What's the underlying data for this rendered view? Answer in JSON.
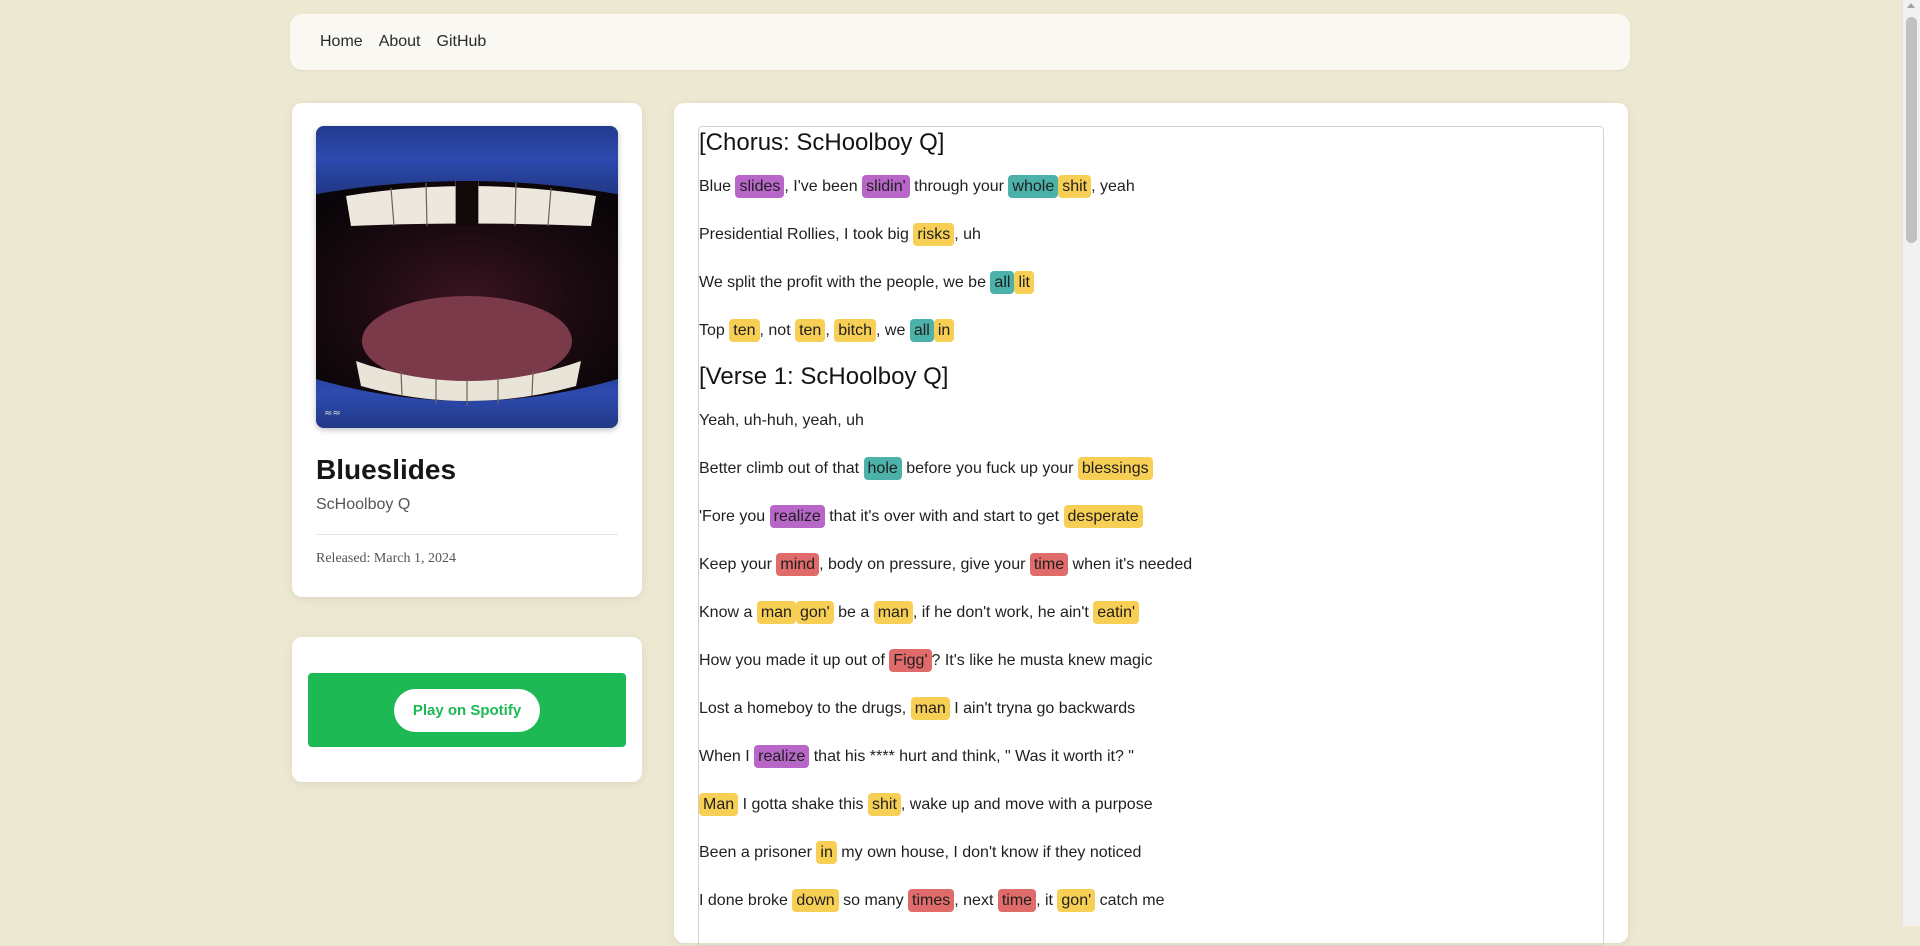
{
  "nav": {
    "links": [
      "Home",
      "About",
      "GitHub"
    ]
  },
  "album": {
    "title": "Blueslides",
    "artist": "ScHoolboy Q",
    "release": "Released: March 1, 2024"
  },
  "spotify": {
    "button_label": "Play on Spotify",
    "panel_color": "#1db954"
  },
  "highlight_colors": {
    "yellow": "#f8cf55",
    "purple": "#b867c9",
    "teal": "#4cb1a8",
    "red": "#e06b6b"
  },
  "lyrics": [
    {
      "type": "heading",
      "text": "[Chorus: ScHoolboy Q]"
    },
    {
      "type": "line",
      "segments": [
        {
          "t": "Blue "
        },
        {
          "t": "slides",
          "c": "purple"
        },
        {
          "t": ", I've been "
        },
        {
          "t": "slidin'",
          "c": "purple"
        },
        {
          "t": " through your "
        },
        {
          "t": "whole",
          "c": "teal"
        },
        {
          "t": "shit",
          "c": "yellow"
        },
        {
          "t": ", yeah"
        }
      ]
    },
    {
      "type": "line",
      "segments": [
        {
          "t": "Presidential Rollies, I took big "
        },
        {
          "t": "risks",
          "c": "yellow"
        },
        {
          "t": ", uh"
        }
      ]
    },
    {
      "type": "line",
      "segments": [
        {
          "t": "We split the profit with the people, we be "
        },
        {
          "t": "all",
          "c": "teal"
        },
        {
          "t": "lit",
          "c": "yellow"
        }
      ]
    },
    {
      "type": "line",
      "segments": [
        {
          "t": "Top "
        },
        {
          "t": "ten",
          "c": "yellow"
        },
        {
          "t": ", not "
        },
        {
          "t": "ten",
          "c": "yellow"
        },
        {
          "t": ", "
        },
        {
          "t": "bitch",
          "c": "yellow"
        },
        {
          "t": ", we "
        },
        {
          "t": "all",
          "c": "teal"
        },
        {
          "t": "in",
          "c": "yellow"
        }
      ]
    },
    {
      "type": "heading",
      "text": "[Verse 1: ScHoolboy Q]"
    },
    {
      "type": "line",
      "segments": [
        {
          "t": "Yeah, uh-huh, yeah, uh"
        }
      ]
    },
    {
      "type": "line",
      "segments": [
        {
          "t": "Better climb out of that "
        },
        {
          "t": "hole",
          "c": "teal"
        },
        {
          "t": " before you fuck up your "
        },
        {
          "t": "blessings",
          "c": "yellow"
        }
      ]
    },
    {
      "type": "line",
      "segments": [
        {
          "t": "'Fore you "
        },
        {
          "t": "realize",
          "c": "purple"
        },
        {
          "t": " that it's over with and start to get "
        },
        {
          "t": "desperate",
          "c": "yellow"
        }
      ]
    },
    {
      "type": "line",
      "segments": [
        {
          "t": "Keep your "
        },
        {
          "t": "mind",
          "c": "red"
        },
        {
          "t": ", body on pressure, give your "
        },
        {
          "t": "time",
          "c": "red"
        },
        {
          "t": " when it's needed"
        }
      ]
    },
    {
      "type": "line",
      "segments": [
        {
          "t": "Know a "
        },
        {
          "t": "man",
          "c": "yellow"
        },
        {
          "t": "gon'",
          "c": "yellow"
        },
        {
          "t": " be a "
        },
        {
          "t": "man",
          "c": "yellow"
        },
        {
          "t": ", if he don't work, he ain't "
        },
        {
          "t": "eatin'",
          "c": "yellow"
        }
      ]
    },
    {
      "type": "line",
      "segments": [
        {
          "t": "How you made it up out of "
        },
        {
          "t": "Figg'",
          "c": "red"
        },
        {
          "t": "? It's like he musta knew magic"
        }
      ]
    },
    {
      "type": "line",
      "segments": [
        {
          "t": "Lost a homeboy to the drugs, "
        },
        {
          "t": "man",
          "c": "yellow"
        },
        {
          "t": " I ain't tryna go backwards"
        }
      ]
    },
    {
      "type": "line",
      "segments": [
        {
          "t": "When I "
        },
        {
          "t": "realize",
          "c": "purple"
        },
        {
          "t": " that his **** hurt and think, \" Was it worth it? \""
        }
      ]
    },
    {
      "type": "line",
      "segments": [
        {
          "t": "Man",
          "c": "yellow"
        },
        {
          "t": " I gotta shake this "
        },
        {
          "t": "shit",
          "c": "yellow"
        },
        {
          "t": ", wake up and move with a purpose"
        }
      ]
    },
    {
      "type": "line",
      "segments": [
        {
          "t": "Been a prisoner "
        },
        {
          "t": "in",
          "c": "yellow"
        },
        {
          "t": " my own house, I don't know if they noticed"
        }
      ]
    },
    {
      "type": "line",
      "segments": [
        {
          "t": "I done broke "
        },
        {
          "t": "down",
          "c": "yellow"
        },
        {
          "t": " so many "
        },
        {
          "t": "times",
          "c": "red"
        },
        {
          "t": ", next "
        },
        {
          "t": "time",
          "c": "red"
        },
        {
          "t": ", it "
        },
        {
          "t": "gon'",
          "c": "yellow"
        },
        {
          "t": " catch me"
        }
      ]
    }
  ]
}
